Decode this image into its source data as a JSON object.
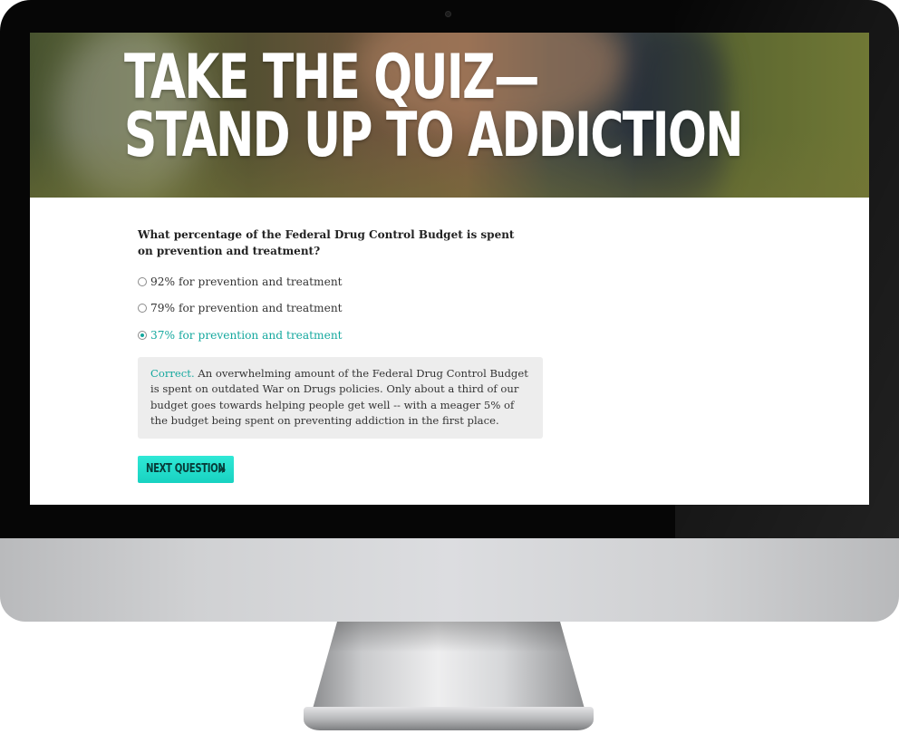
{
  "hero": {
    "line1": "TAKE THE QUIZ—",
    "line2": "STAND UP TO ADDICTION"
  },
  "quiz": {
    "question": "What percentage of the Federal Drug Control Budget is spent on prevention and treatment?",
    "options": [
      {
        "label": "92% for prevention and treatment",
        "selected": false
      },
      {
        "label": "79% for prevention and treatment",
        "selected": false
      },
      {
        "label": "37% for prevention and treatment",
        "selected": true
      }
    ],
    "feedback": {
      "status": "Correct.",
      "text": " An overwhelming amount of the Federal Drug Control Budget is spent on outdated War on Drugs policies. Only about a third of our budget goes towards helping people get well -- with a meager 5% of the budget being spent on preventing addiction in the first place."
    },
    "next_button": {
      "label": "NEXT QUESTION",
      "icon": "double-chevron-right-icon",
      "glyph": "»"
    }
  },
  "colors": {
    "accent": "#14a89e",
    "button": "#1fdcc9",
    "feedback_bg": "#ededed"
  }
}
